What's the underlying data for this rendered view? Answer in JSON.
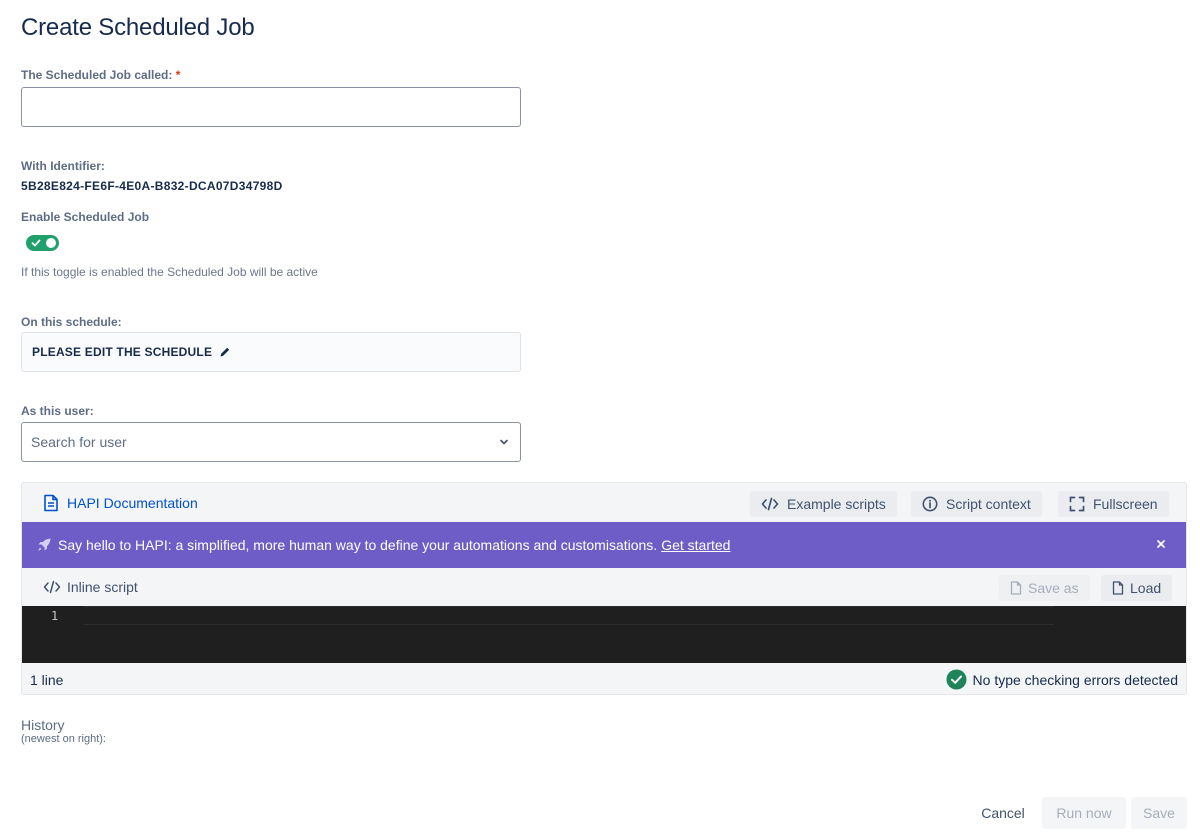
{
  "page": {
    "title": "Create Scheduled Job"
  },
  "form": {
    "name_label": "The Scheduled Job called:",
    "required_mark": "*",
    "name_value": "",
    "identifier_label": "With Identifier:",
    "identifier_value": "5B28E824-FE6F-4E0A-B832-DCA07D34798D",
    "enable_label": "Enable Scheduled Job",
    "enable_on": true,
    "enable_helper": "If this toggle is enabled the Scheduled Job will be active",
    "schedule_label": "On this schedule:",
    "schedule_value": "PLEASE EDIT THE SCHEDULE",
    "user_label": "As this user:",
    "user_placeholder": "Search for user"
  },
  "editor": {
    "doc_link": "HAPI Documentation",
    "example_scripts": "Example scripts",
    "script_context": "Script context",
    "fullscreen": "Fullscreen",
    "banner_text": "Say hello to HAPI: a simplified, more human way to define your automations and customisations.",
    "banner_link": "Get started",
    "inline_label": "Inline script",
    "save_as": "Save as",
    "load": "Load",
    "line_number": "1",
    "line_count": "1 line",
    "status": "No type checking errors detected"
  },
  "history": {
    "label": "History",
    "sublabel": "(newest on right):"
  },
  "footer": {
    "cancel": "Cancel",
    "run_now": "Run now",
    "save": "Save"
  },
  "colors": {
    "accent": "#0052cc",
    "toggle_on": "#22a06b",
    "banner": "#6e5dc6",
    "editor_bg": "#1f1f1f"
  },
  "icons": {
    "doc": "document-icon",
    "code": "code-icon",
    "info": "info-icon",
    "fullscreen": "fullscreen-icon",
    "rocket": "rocket-icon",
    "close": "close-icon",
    "pencil": "pencil-icon",
    "chevron": "chevron-down-icon",
    "file": "file-icon",
    "check_circle": "check-circle-icon"
  }
}
